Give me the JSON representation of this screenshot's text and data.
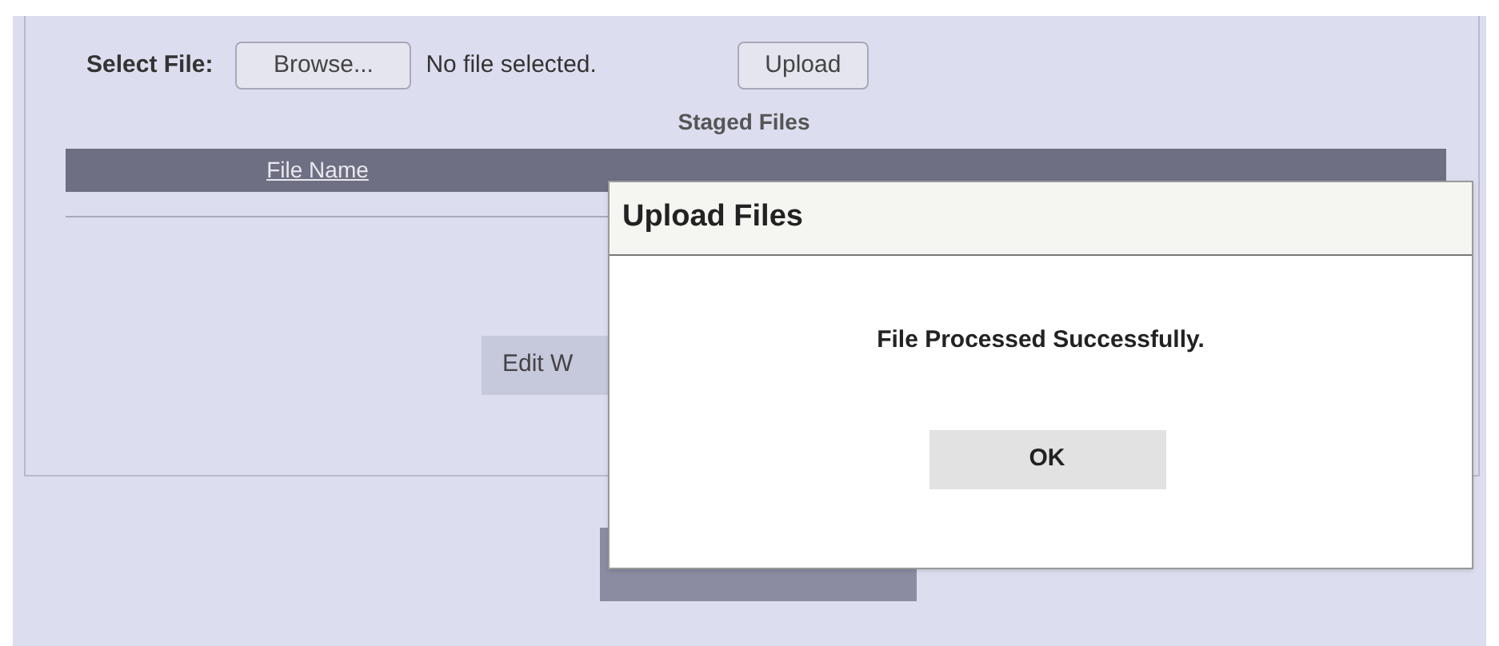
{
  "upload_form": {
    "select_label": "Select File:",
    "browse_button": "Browse...",
    "file_status": "No file selected.",
    "upload_button": "Upload"
  },
  "staged_files": {
    "title": "Staged Files",
    "columns": [
      "File Name"
    ]
  },
  "edit_button": "Edit W",
  "dialog": {
    "title": "Upload Files",
    "message": "File Processed Successfully.",
    "ok_button": "OK"
  }
}
